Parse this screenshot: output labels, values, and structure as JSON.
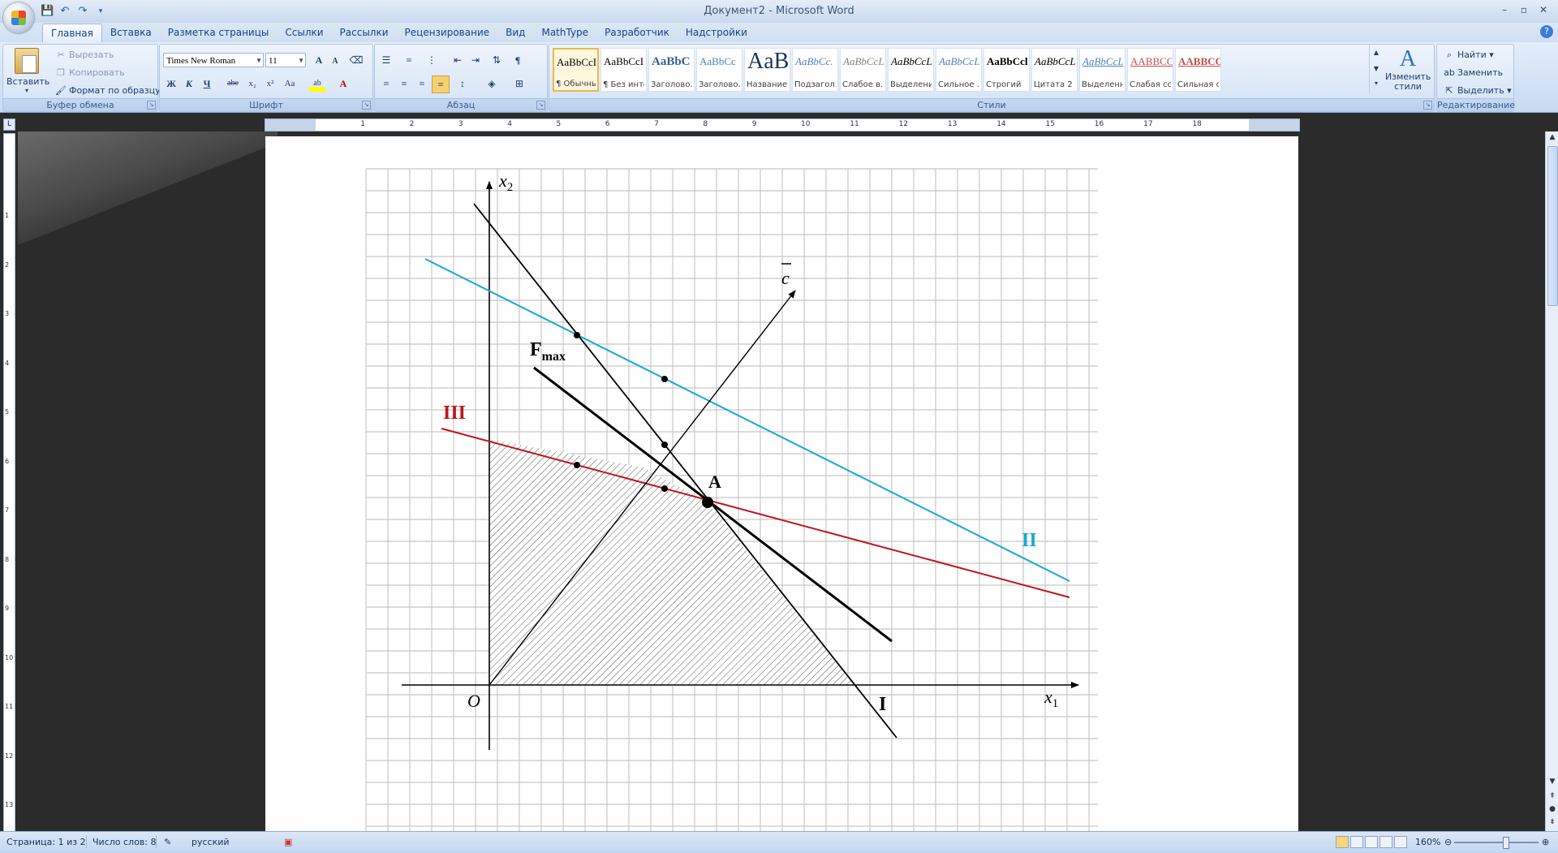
{
  "window": {
    "title": "Документ2 - Microsoft Word",
    "controls": [
      "–",
      "▫",
      "✕"
    ]
  },
  "quick_access": [
    "save-icon",
    "undo-icon",
    "redo-icon",
    "customize-icon"
  ],
  "tabs": [
    {
      "label": "Главная",
      "active": true
    },
    {
      "label": "Вставка"
    },
    {
      "label": "Разметка страницы"
    },
    {
      "label": "Ссылки"
    },
    {
      "label": "Рассылки"
    },
    {
      "label": "Рецензирование"
    },
    {
      "label": "Вид"
    },
    {
      "label": "MathType"
    },
    {
      "label": "Разработчик"
    },
    {
      "label": "Надстройки"
    }
  ],
  "ribbon": {
    "clipboard": {
      "label": "Буфер обмена",
      "paste": "Вставить",
      "cut": "Вырезать",
      "copy": "Копировать",
      "format_painter": "Формат по образцу"
    },
    "font": {
      "label": "Шрифт",
      "font_name": "Times New Roman",
      "font_size": "11",
      "bold": "Ж",
      "italic": "К",
      "underline": "Ч",
      "strike": "abe",
      "subscript": "x₂",
      "superscript": "x²",
      "change_case": "Aa",
      "grow": "A",
      "shrink": "A"
    },
    "paragraph": {
      "label": "Абзац"
    },
    "styles": {
      "label": "Стили",
      "items": [
        {
          "sample": "AaBbCcI",
          "name": "¶ Обычный",
          "color": "#000000"
        },
        {
          "sample": "AaBbCcI",
          "name": "¶ Без инте...",
          "color": "#000000"
        },
        {
          "sample": "AaBbC",
          "name": "Заголово...",
          "color": "#365f91"
        },
        {
          "sample": "AaBbCc",
          "name": "Заголово...",
          "color": "#4f81bd"
        },
        {
          "sample": "AaB",
          "name": "Название",
          "color": "#17365d"
        },
        {
          "sample": "AaBbCc.",
          "name": "Подзагол...",
          "color": "#4f81bd"
        },
        {
          "sample": "AaBbCcL",
          "name": "Слабое в...",
          "color": "#808080"
        },
        {
          "sample": "AaBbCcL",
          "name": "Выделение",
          "color": "#000000"
        },
        {
          "sample": "AaBbCcL",
          "name": "Сильное ...",
          "color": "#4f81bd"
        },
        {
          "sample": "AaBbCcl",
          "name": "Строгий",
          "color": "#000000"
        },
        {
          "sample": "AaBbCcL",
          "name": "Цитата 2",
          "color": "#000000"
        },
        {
          "sample": "AaBbCcL",
          "name": "Выделенн...",
          "color": "#4f81bd"
        },
        {
          "sample": "AABBCCI",
          "name": "Слабая сс...",
          "color": "#c0504d"
        },
        {
          "sample": "AABBCC",
          "name": "Сильная с...",
          "color": "#c0504d"
        }
      ],
      "change_styles": "Изменить стили"
    },
    "editing": {
      "label": "Редактирование",
      "find": "Найти",
      "replace": "Заменить",
      "select": "Выделить"
    }
  },
  "ruler": {
    "h_numbers": [
      "1",
      "2",
      "3",
      "4",
      "5",
      "6",
      "7",
      "8",
      "9",
      "10",
      "11",
      "12",
      "13",
      "14",
      "15",
      "16",
      "17",
      "18"
    ],
    "v_numbers": [
      "1",
      "2",
      "3",
      "4",
      "5",
      "6",
      "7",
      "8",
      "9",
      "10",
      "11",
      "12",
      "13"
    ]
  },
  "figure": {
    "axis_x_label": "x",
    "axis_x_sub": "1",
    "axis_y_label": "x",
    "axis_y_sub": "2",
    "origin_label": "O",
    "vector_label": "c",
    "fmax_label": "F",
    "fmax_sub": "max",
    "point_label": "A",
    "line_labels": {
      "I": "I",
      "II": "II",
      "III": "III"
    },
    "colors": {
      "line_II": "#1aa7d6",
      "line_III": "#c0151b",
      "axes": "#000000"
    }
  },
  "status": {
    "page": "Страница: 1 из 2",
    "words": "Число слов: 8",
    "language": "русский",
    "zoom": "160%"
  }
}
